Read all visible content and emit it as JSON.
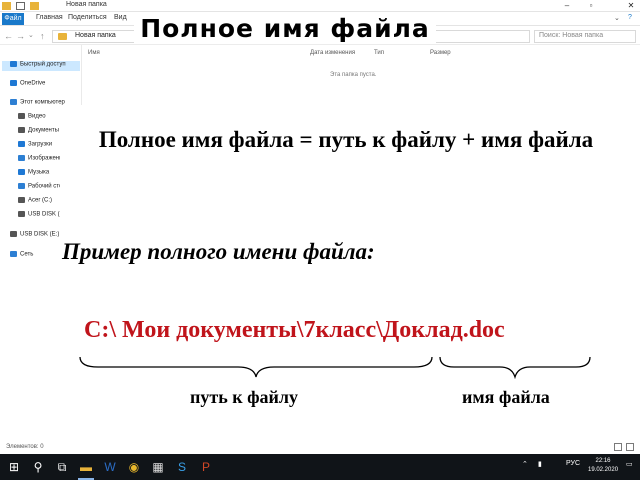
{
  "window": {
    "title": "Новая папка",
    "ribbon_tabs": [
      "Файл",
      "Главная",
      "Поделиться",
      "Вид"
    ],
    "address": "Новая папка",
    "search_placeholder": "Поиск: Новая папка",
    "columns": [
      "Имя",
      "Дата изменения",
      "Тип",
      "Размер"
    ],
    "empty_message": "Эта папка пуста."
  },
  "sidebar": {
    "items": [
      {
        "label": "Быстрый доступ",
        "icon": "star-icon",
        "color": "#1e78d4"
      },
      {
        "label": "OneDrive",
        "icon": "cloud-icon",
        "color": "#1e78d4"
      },
      {
        "label": "Этот компьютер",
        "icon": "computer-icon",
        "color": "#2d7fd3"
      },
      {
        "label": "Видео",
        "icon": "video-icon",
        "color": "#555555"
      },
      {
        "label": "Документы",
        "icon": "documents-icon",
        "color": "#555555"
      },
      {
        "label": "Загрузки",
        "icon": "downloads-icon",
        "color": "#1e78d4"
      },
      {
        "label": "Изображения",
        "icon": "pictures-icon",
        "color": "#2d7fd3"
      },
      {
        "label": "Музыка",
        "icon": "music-icon",
        "color": "#1e78d4"
      },
      {
        "label": "Рабочий стол",
        "icon": "desktop-icon",
        "color": "#2d7fd3"
      },
      {
        "label": "Acer (C:)",
        "icon": "drive-icon",
        "color": "#555555"
      },
      {
        "label": "USB DISK (E:)",
        "icon": "usb-icon",
        "color": "#555555"
      },
      {
        "label": "USB DISK (E:)",
        "icon": "usb-icon",
        "color": "#555555"
      },
      {
        "label": "Сеть",
        "icon": "network-icon",
        "color": "#2d7fd3"
      }
    ]
  },
  "status": {
    "elements_count": "Элементов: 0"
  },
  "taskbar": {
    "tray_lang": "РУС",
    "time": "22:16",
    "date": "19.02.2020"
  },
  "slide": {
    "title": "Полное имя файла",
    "formula": "Полное имя файла = путь к файлу + имя файла",
    "example_label": "Пример полного имени файла:",
    "path_example": "С:\\ Мои документы\\7класс\\Доклад.doc",
    "path_label": "путь к файлу",
    "name_label": "имя файла",
    "accent_color": "#c0141b"
  }
}
